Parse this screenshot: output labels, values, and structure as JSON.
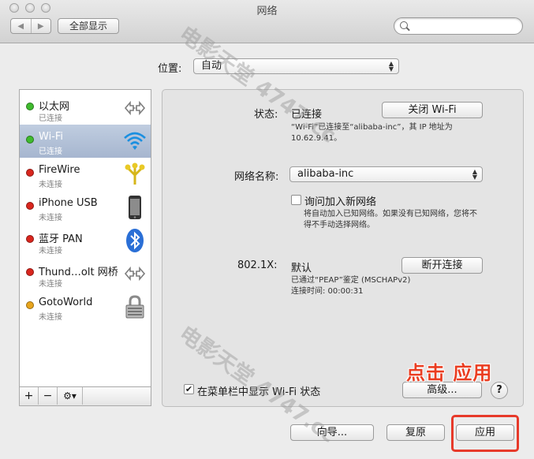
{
  "window": {
    "title": "网络"
  },
  "toolbar": {
    "back": "◀",
    "forward": "▶",
    "show_all": "全部显示",
    "search_placeholder": ""
  },
  "location": {
    "label": "位置:",
    "value": "自动"
  },
  "services": [
    {
      "name": "以太网",
      "status": "已连接",
      "dot_color": "#3fbb2e",
      "icon": "ethernet-arrows-icon"
    },
    {
      "name": "Wi-Fi",
      "status": "已连接",
      "dot_color": "#3fbb2e",
      "icon": "wifi-icon"
    },
    {
      "name": "FireWire",
      "status": "未连接",
      "dot_color": "#d9261e",
      "icon": "firewire-icon"
    },
    {
      "name": "iPhone USB",
      "status": "未连接",
      "dot_color": "#d9261e",
      "icon": "iphone-icon"
    },
    {
      "name": "蓝牙 PAN",
      "status": "未连接",
      "dot_color": "#d9261e",
      "icon": "bluetooth-icon"
    },
    {
      "name": "Thund…olt 网桥",
      "status": "未连接",
      "dot_color": "#d9261e",
      "icon": "thunderbolt-bridge-icon"
    },
    {
      "name": "GotoWorld",
      "status": "未连接",
      "dot_color": "#e8a51d",
      "icon": "lock-icon"
    }
  ],
  "sidebar_buttons": {
    "add": "+",
    "remove": "−",
    "action": "⚙▾"
  },
  "detail": {
    "status_label": "状态:",
    "status_value": "已连接",
    "toggle_wifi": "关闭 Wi-Fi",
    "status_desc_1": "“Wi-Fi”已连接至“alibaba-inc”，其 IP 地址为",
    "status_desc_2": "10.62.9.41。",
    "network_name_label": "网络名称:",
    "network_name_value": "alibaba-inc",
    "ask_join_label": "询问加入新网络",
    "ask_join_desc_1": "将自动加入已知网络。如果没有已知网络，您将不",
    "ask_join_desc_2": "得不手动选择网络。",
    "dot1x_label": "802.1X:",
    "dot1x_value": "默认",
    "disconnect": "断开连接",
    "dot1x_desc_1": "已通过“PEAP”鉴定 (MSCHAPv2)",
    "dot1x_desc_2": "连接时间:  00:00:31",
    "show_menubar_label": "在菜单栏中显示 Wi-Fi 状态",
    "advanced": "高级...",
    "help": "?"
  },
  "footer": {
    "assist": "向导...",
    "revert": "复原",
    "apply": "应用"
  },
  "annotation": {
    "text": "点击 应用",
    "color": "#ea3d21"
  },
  "watermark": {
    "line1": "电影天堂 4747.cc",
    "line2": "电影天堂 4747.cc"
  }
}
